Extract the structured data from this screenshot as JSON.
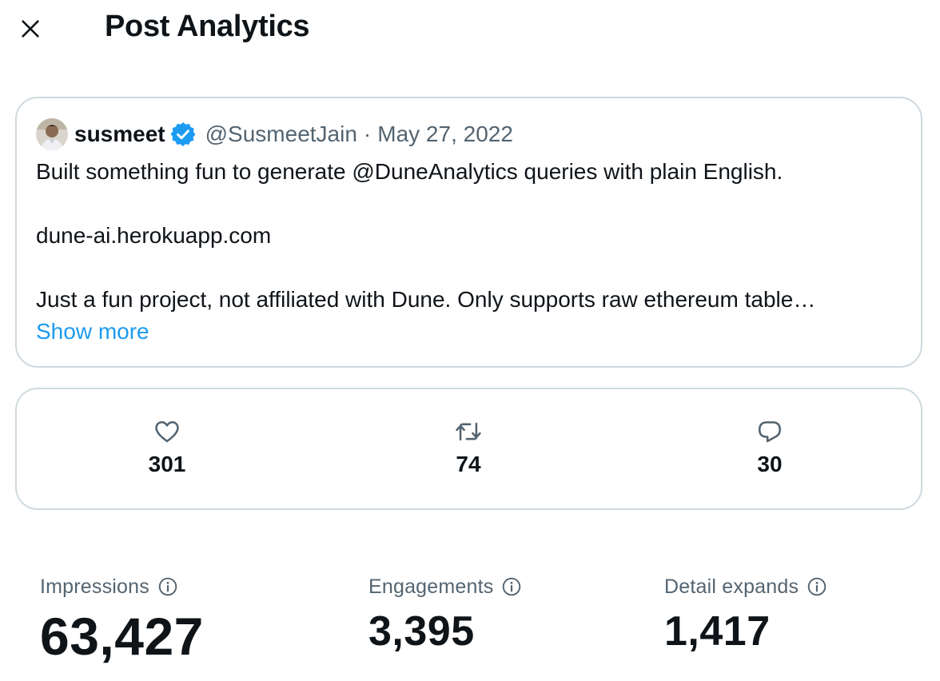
{
  "header": {
    "title": "Post Analytics",
    "close_icon": "close-icon"
  },
  "tweet": {
    "author_name": "susmeet",
    "verified_icon": "verified-badge-icon",
    "handle": "@SusmeetJain",
    "separator": "·",
    "date": "May 27, 2022",
    "lines": [
      "Built something fun to generate @DuneAnalytics queries with plain English.",
      "dune-ai.herokuapp.com",
      "Just a fun project, not affiliated with Dune. Only supports raw ethereum table…"
    ],
    "show_more": "Show more"
  },
  "engagement": {
    "likes": {
      "icon": "heart-icon",
      "count": "301"
    },
    "reposts": {
      "icon": "repost-icon",
      "count": "74"
    },
    "replies": {
      "icon": "reply-icon",
      "count": "30"
    }
  },
  "metrics": [
    {
      "label": "Impressions",
      "value": "63,427",
      "icon": "info-icon"
    },
    {
      "label": "Engagements",
      "value": "3,395",
      "icon": "info-icon"
    },
    {
      "label": "Detail expands",
      "value": "1,417",
      "icon": "info-icon"
    }
  ],
  "colors": {
    "text_primary": "#0f1419",
    "text_secondary": "#536471",
    "link": "#1d9bf0",
    "border": "#cfd9de"
  }
}
